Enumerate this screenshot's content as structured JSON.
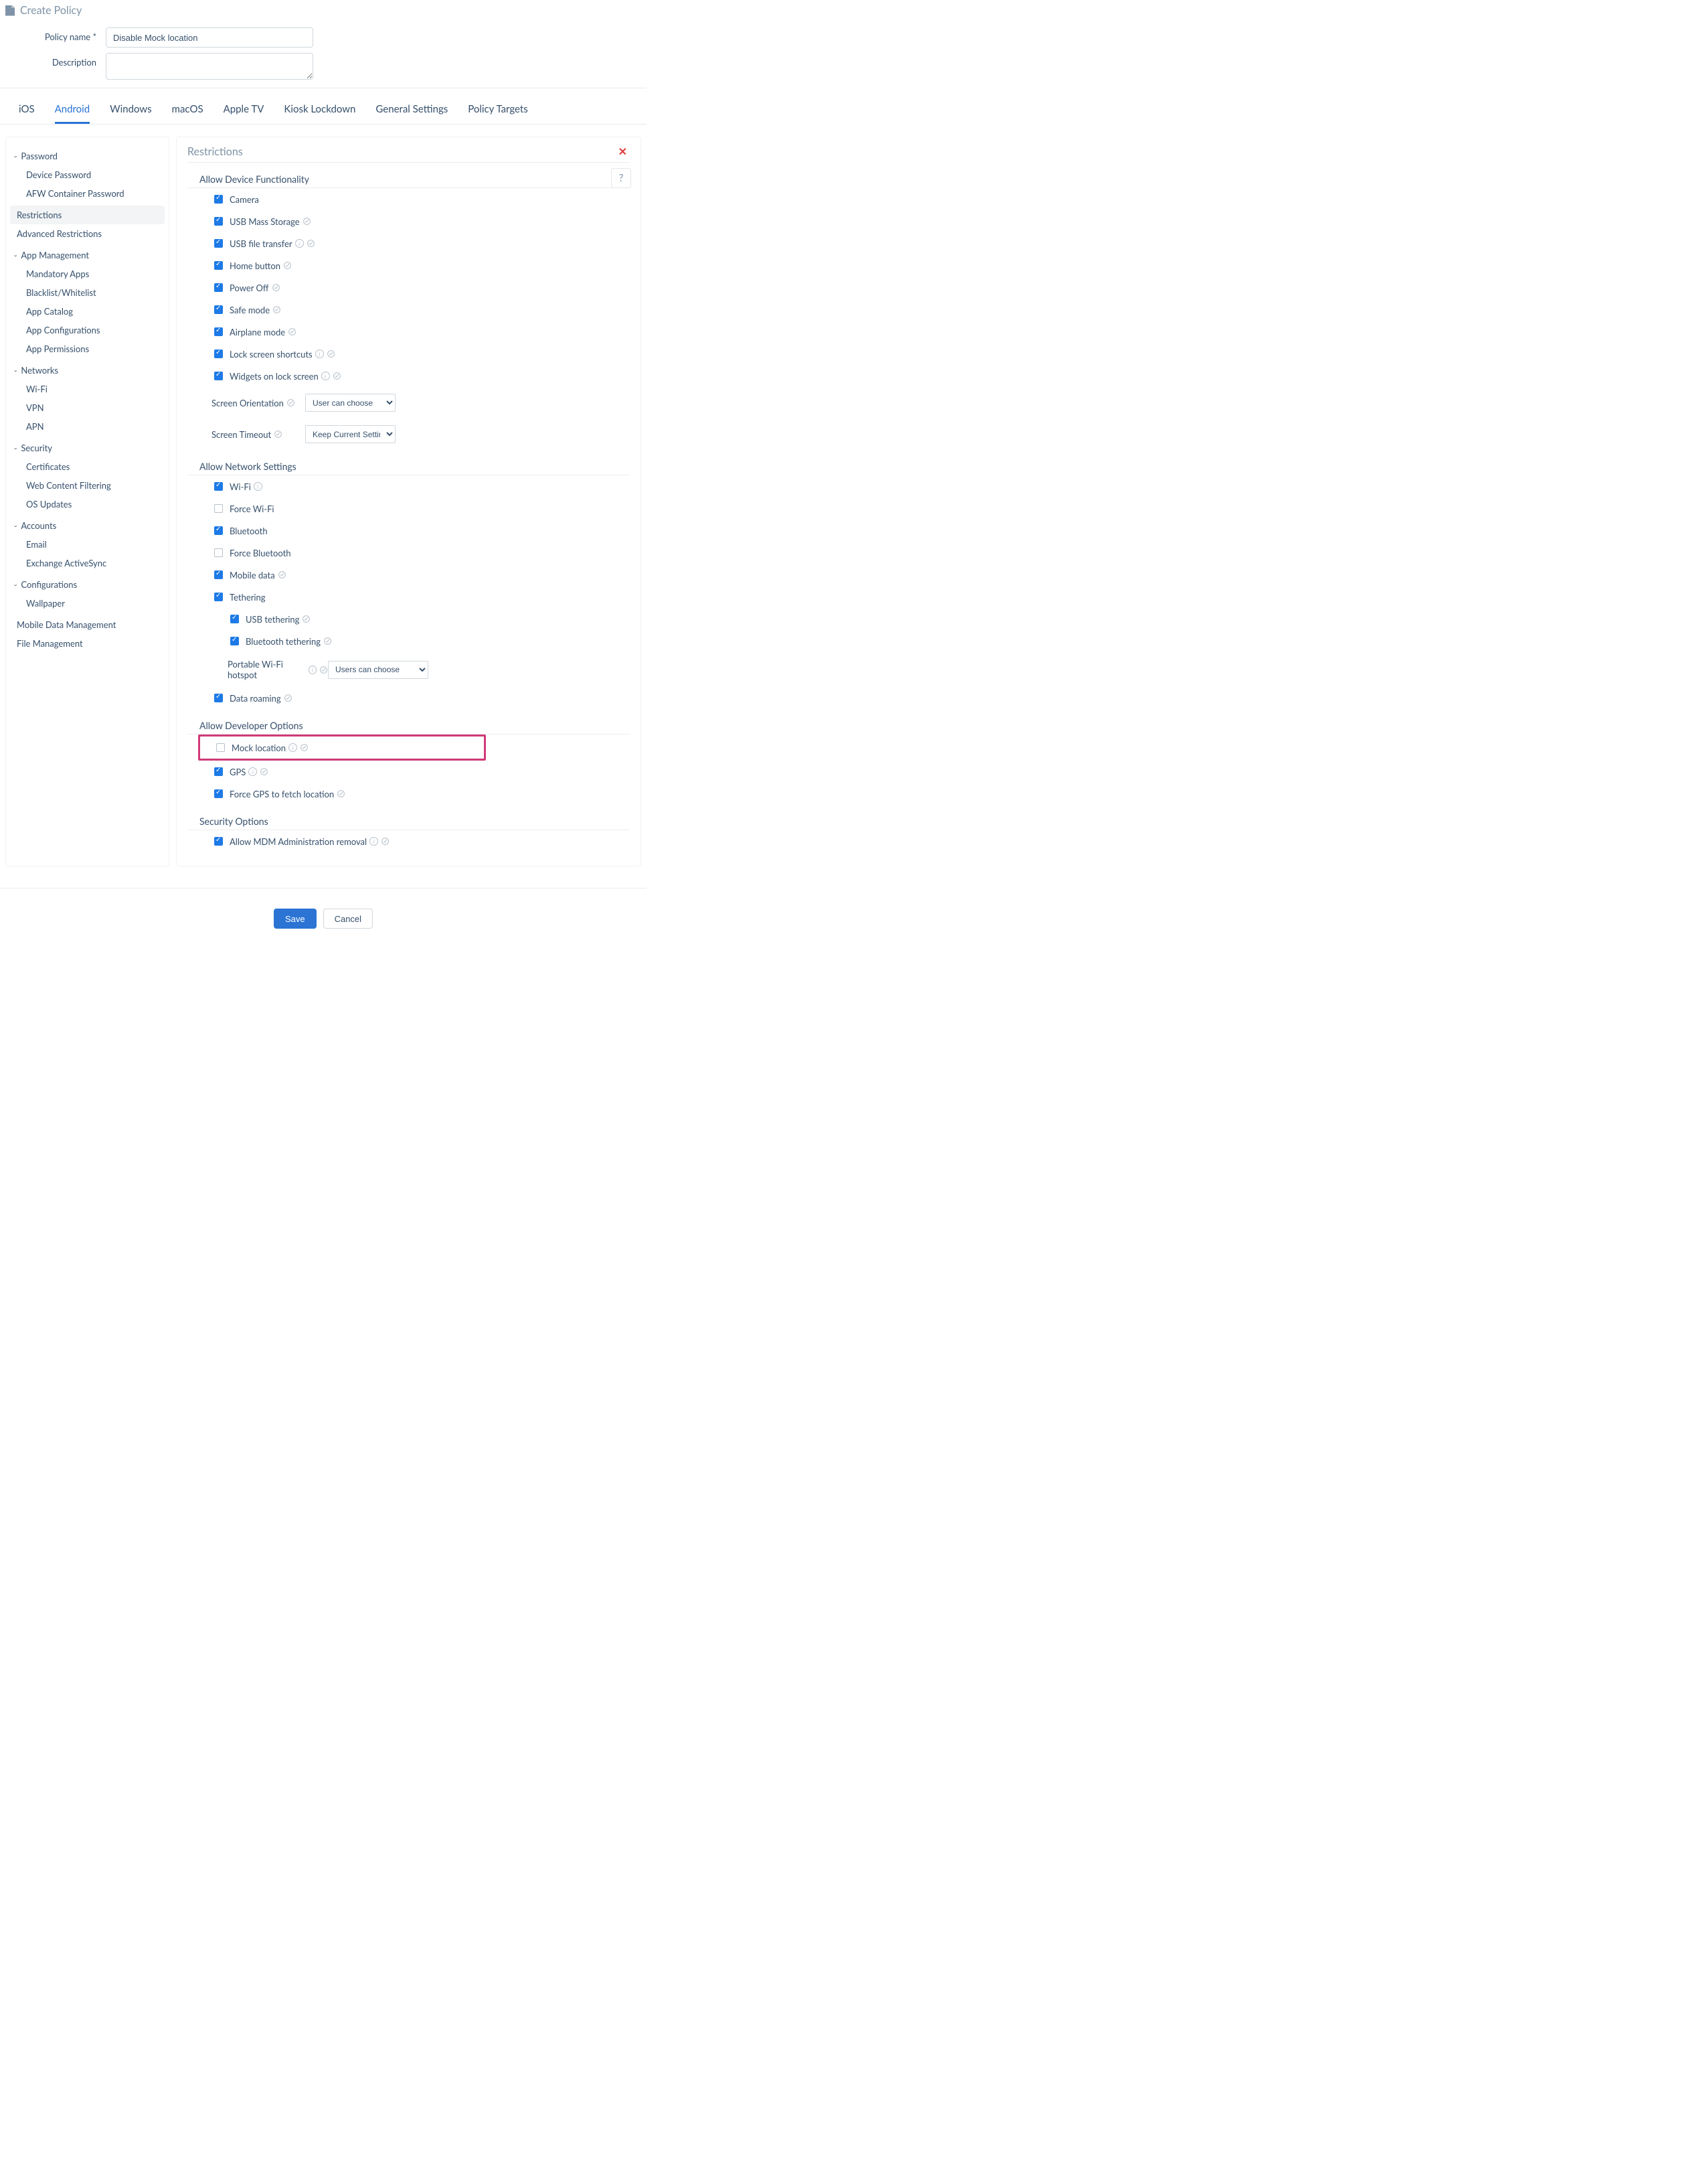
{
  "header": {
    "title": "Create Policy",
    "policy_name_label": "Policy name *",
    "policy_name_value": "Disable Mock location",
    "description_label": "Description",
    "description_value": ""
  },
  "tabs": [
    "iOS",
    "Android",
    "Windows",
    "macOS",
    "Apple TV",
    "Kiosk Lockdown",
    "General Settings",
    "Policy Targets"
  ],
  "active_tab": "Android",
  "sidebar": {
    "groups": [
      {
        "title": "Password",
        "items": [
          "Device Password",
          "AFW Container Password"
        ]
      },
      {
        "title": null,
        "items": [
          "Restrictions",
          "Advanced Restrictions"
        ]
      },
      {
        "title": "App Management",
        "items": [
          "Mandatory Apps",
          "Blacklist/Whitelist",
          "App Catalog",
          "App Configurations",
          "App Permissions"
        ]
      },
      {
        "title": "Networks",
        "items": [
          "Wi-Fi",
          "VPN",
          "APN"
        ]
      },
      {
        "title": "Security",
        "items": [
          "Certificates",
          "Web Content Filtering",
          "OS Updates"
        ]
      },
      {
        "title": "Accounts",
        "items": [
          "Email",
          "Exchange ActiveSync"
        ]
      },
      {
        "title": "Configurations",
        "items": [
          "Wallpaper"
        ]
      },
      {
        "title": null,
        "items": [
          "Mobile Data Management",
          "File Management"
        ]
      }
    ],
    "active_item": "Restrictions"
  },
  "content": {
    "title": "Restrictions",
    "help_label": "?",
    "sections": {
      "functionality": {
        "title": "Allow Device Functionality",
        "opts": {
          "camera": "Camera",
          "usb_mass": "USB Mass Storage",
          "usb_file": "USB file transfer",
          "home": "Home button",
          "power": "Power Off",
          "safe": "Safe mode",
          "airplane": "Airplane mode",
          "lock_short": "Lock screen shortcuts",
          "widgets": "Widgets on lock screen",
          "orient_label": "Screen Orientation",
          "orient_value": "User can choose",
          "timeout_label": "Screen Timeout",
          "timeout_value": "Keep Current Settings"
        }
      },
      "network": {
        "title": "Allow Network Settings",
        "opts": {
          "wifi": "Wi-Fi",
          "force_wifi": "Force Wi-Fi",
          "bt": "Bluetooth",
          "force_bt": "Force Bluetooth",
          "mobile": "Mobile data",
          "tether": "Tethering",
          "usb_tether": "USB tethering",
          "bt_tether": "Bluetooth tethering",
          "hotspot_label": "Portable Wi-Fi hotspot",
          "hotspot_value": "Users can choose",
          "roaming": "Data roaming"
        }
      },
      "developer": {
        "title": "Allow Developer Options",
        "opts": {
          "mock": "Mock location",
          "gps": "GPS",
          "force_gps": "Force GPS to fetch location"
        }
      },
      "security": {
        "title": "Security Options",
        "opts": {
          "mdm_removal": "Allow MDM Administration removal"
        }
      }
    }
  },
  "footer": {
    "save": "Save",
    "cancel": "Cancel"
  }
}
